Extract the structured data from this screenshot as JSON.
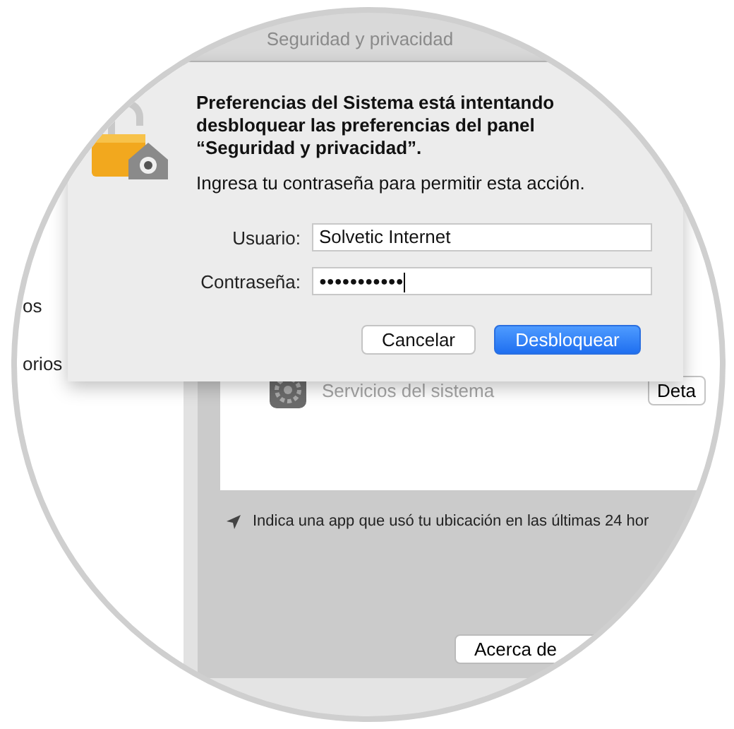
{
  "window": {
    "title": "Seguridad y privacidad"
  },
  "sidebar": {
    "items": [
      {
        "label": "os"
      },
      {
        "label": "orios"
      }
    ]
  },
  "services": [
    {
      "label": "Servicios del sistema",
      "button": "Deta"
    }
  ],
  "location_note": "Indica una app que usó tu ubicación en las últimas 24 hor",
  "about_button": "Acerca de",
  "dialog": {
    "message": "Preferencias del Sistema está intentando desbloquear las preferencias del panel “Seguridad y privacidad”.",
    "prompt": "Ingresa tu contraseña para permitir esta acción.",
    "fields": [
      {
        "label": "Usuario:",
        "value": "Solvetic Internet",
        "kind": "text"
      },
      {
        "label": "Contraseña:",
        "value": "●●●●●●●●●●●",
        "kind": "password"
      }
    ],
    "buttons": [
      {
        "label": "Cancelar",
        "default": false
      },
      {
        "label": "Desbloquear",
        "default": true
      }
    ]
  }
}
